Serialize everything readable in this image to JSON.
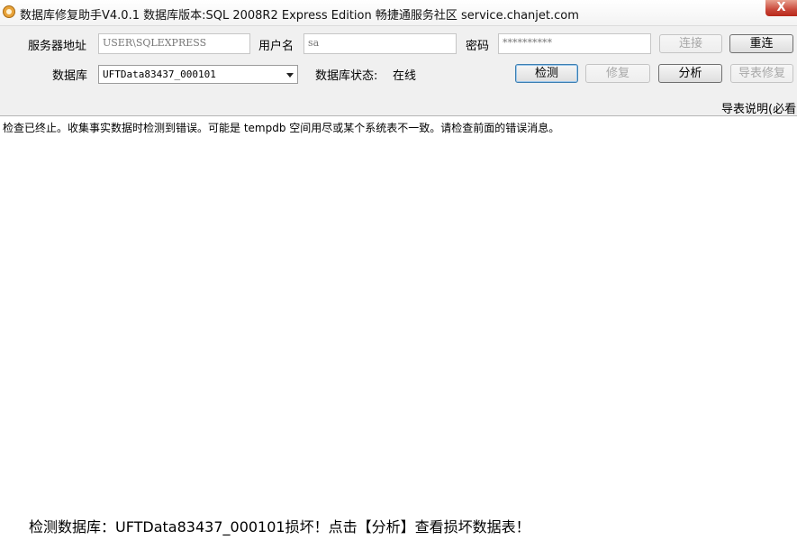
{
  "window": {
    "title": "数据库修复助手V4.0.1 数据库版本:SQL 2008R2 Express Edition  畅捷通服务社区 service.chanjet.com",
    "close_glyph": "X",
    "icon": "app-icon"
  },
  "connection": {
    "server_label": "服务器地址",
    "server_value": "USER\\SQLEXPRESS",
    "user_label": "用户名",
    "user_value": "sa",
    "password_label": "密码",
    "password_value": "**********",
    "connect_label": "连接",
    "reconnect_label": "重连"
  },
  "database": {
    "label": "数据库",
    "selected": "UFTData83437_000101",
    "status_label": "数据库状态:",
    "status_value": "在线",
    "check_label": "检测",
    "repair_label": "修复",
    "analyze_label": "分析",
    "export_repair_label": "导表修复"
  },
  "help_link": "导表说明(必看",
  "log": {
    "lines": [
      "检查已终止。收集事实数据时检测到错误。可能是 tempdb 空间用尽或某个系统表不一致。请检查前面的错误消息。"
    ]
  },
  "status_message": "检测数据库：UFTData83437_000101损坏！点击【分析】查看损坏数据表！"
}
